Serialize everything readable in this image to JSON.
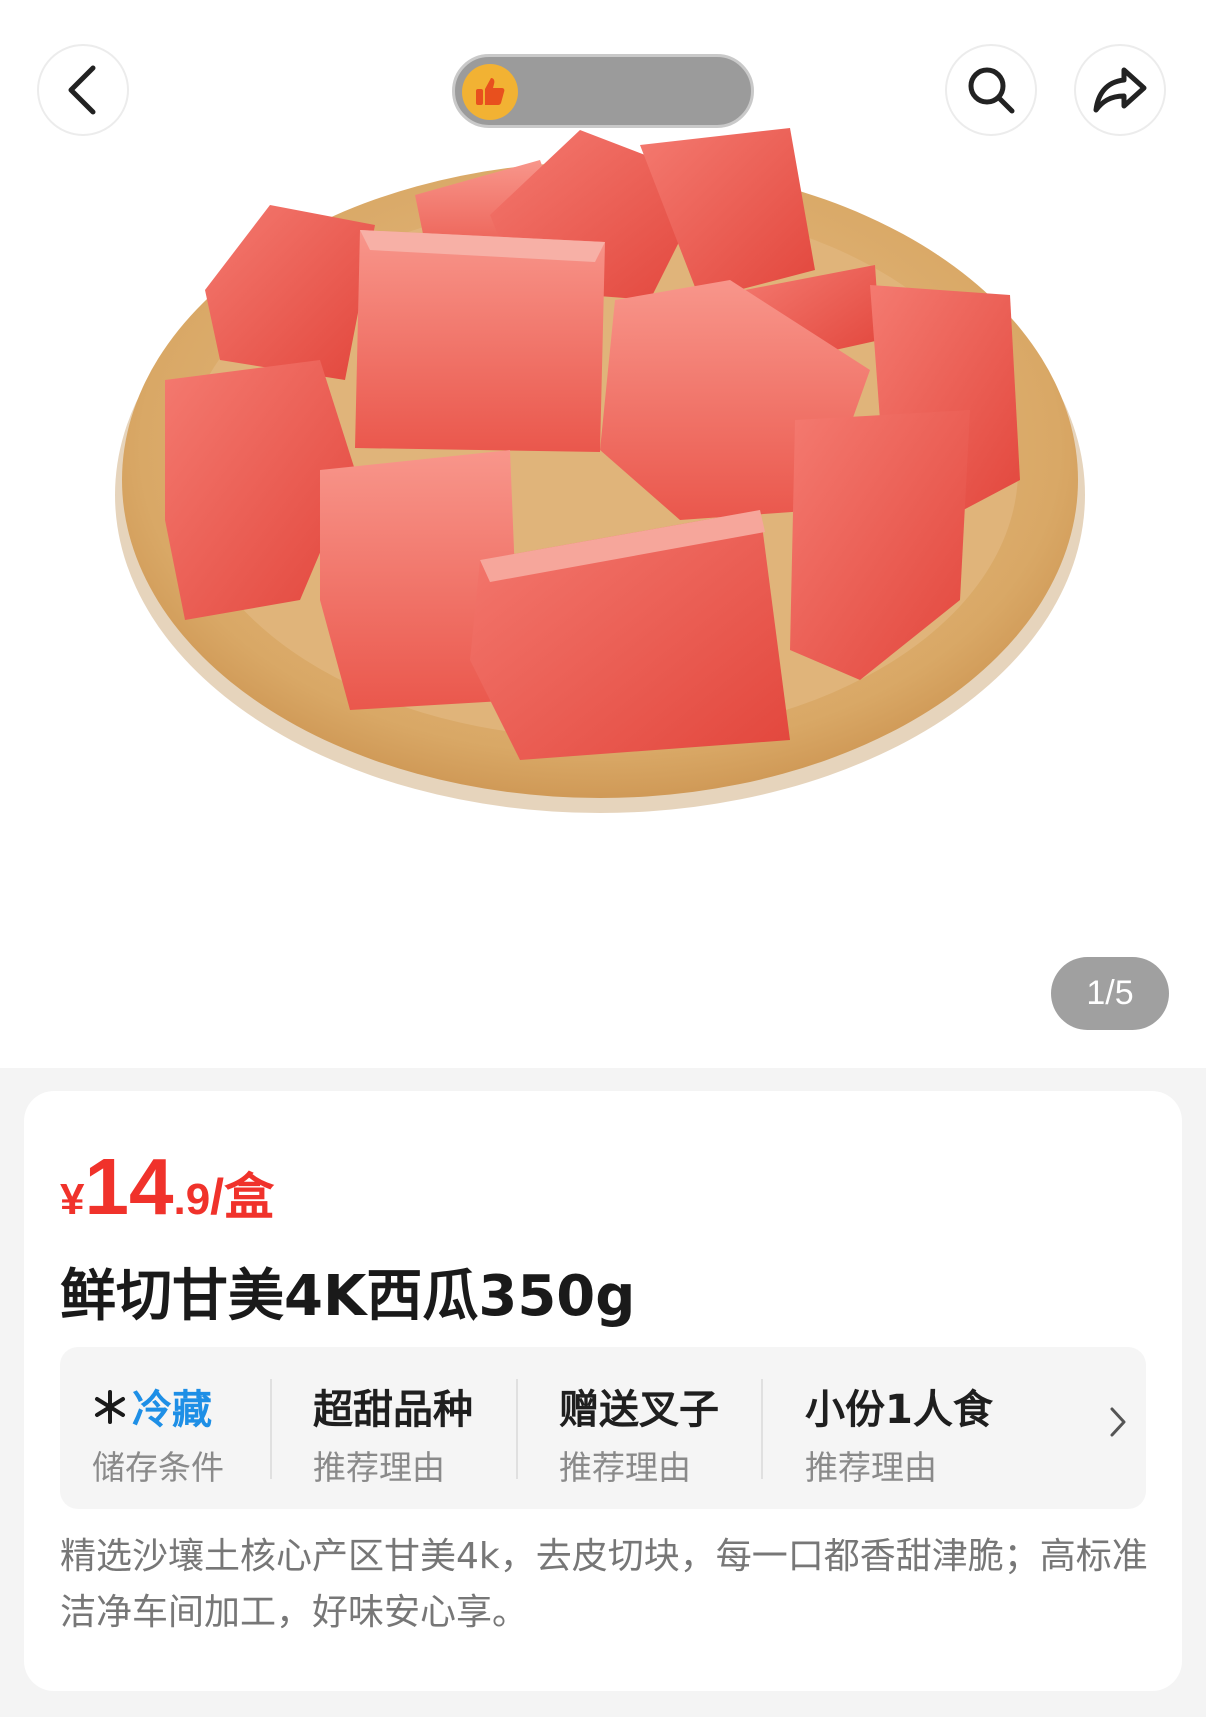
{
  "header": {
    "back_icon": "chevron-left-icon",
    "search_icon": "search-icon",
    "share_icon": "share-arrow-icon",
    "pill_icon": "thumbs-up-icon"
  },
  "gallery": {
    "counter": "1/5"
  },
  "product": {
    "price": {
      "currency": "¥",
      "integer": "14",
      "decimal": ".9",
      "unit": "/盒"
    },
    "title": "鲜切甘美4K西瓜350g",
    "tags": [
      {
        "main": "冷藏",
        "sub": "储存条件",
        "icon": "snowflake-icon"
      },
      {
        "main": "超甜品种",
        "sub": "推荐理由"
      },
      {
        "main": "赠送叉子",
        "sub": "推荐理由"
      },
      {
        "main": "小份1人食",
        "sub": "推荐理由"
      }
    ],
    "description": "精选沙壤土核心产区甘美4k，去皮切块，每一口都香甜津脆；高标准洁净车间加工，好味安心享。"
  },
  "colors": {
    "price_red": "#f0322b",
    "cold_blue": "#1e8fe6"
  }
}
